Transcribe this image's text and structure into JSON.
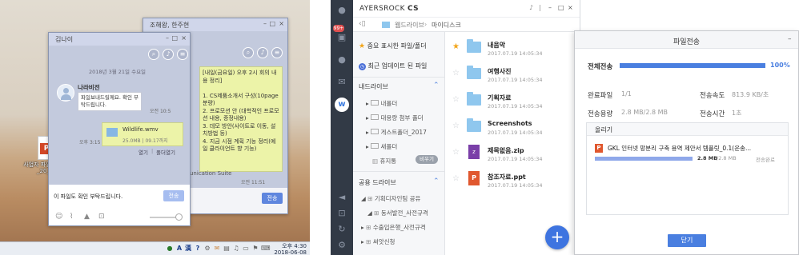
{
  "desktop": {
    "window_back": {
      "title": "조해왕, 한주현",
      "message": "[내일(금요일) 오후 2시 회의 내용 정리]\n\n1. CS제품소개서 구성(10page 분량)\n2. 프로모션 안 (대학적인 프로모션 내용, 증정내용)\n3. 데모 방안(사이트로 이동, 설치방법 등)\n4. 지금 시점 계획 기능 정리(예일 클라이언트 향 기능)",
      "suite_text": "unication Suite",
      "time1": "오전 11:51",
      "send_label": "전송"
    },
    "window_front": {
      "title": "김나이",
      "date_divider": "2018년 3월 21일 수요일",
      "sender": "나라비전",
      "message1": "파일보내드릴께요. 확인 부탁드립니다.",
      "time_msg1": "오전 10:5",
      "file_name": "Wildlife.wmv",
      "file_meta": "25.0MB | 09.17까지",
      "time_file": "오후 3:15",
      "open_label": "열기",
      "open_folder_label": "폴더열기",
      "input_text": "이 파일도 확인 부탁드립니다.",
      "send_label": "전송"
    },
    "desktop_file": {
      "label": "사업자 파일 가능_20_"
    },
    "taskbar": {
      "ime_a": "A",
      "ime_han": "漢",
      "time": "오후 4:30",
      "date": "2018-06-08"
    }
  },
  "app": {
    "brand": "AYERSROCK",
    "brand_suffix": "CS",
    "badge_count": "99+",
    "breadcrumb": {
      "root": "웹드라이브",
      "current": "마이디스크"
    },
    "sidebar": {
      "important": "중요 표시한 파일/폴더",
      "recent": "최근 업데이트 된 파일",
      "my_drive_header": "내드라이브",
      "my_drive_items": [
        "내폴더",
        "대용량 첨부 폴더",
        "게스트폴더_2017",
        "새폴더",
        "휴지통"
      ],
      "trash_badge": "비우기",
      "shared_header": "공용 드라이브",
      "shared_items": [
        "기획디자인팀 공유",
        "동서발전_사전규격",
        "수출입은행_사전규격",
        "써앗신청"
      ]
    },
    "files": [
      {
        "name": "내음악",
        "date": "2017.07.19  14:05:34",
        "type": "folder",
        "starred": true
      },
      {
        "name": "여행사진",
        "date": "2017.07.19  14:05:34",
        "type": "folder",
        "starred": false
      },
      {
        "name": "기획자료",
        "date": "2017.07.19  14:05:34",
        "type": "folder",
        "starred": false
      },
      {
        "name": "Screenshots",
        "date": "2017.07.19  14:05:34",
        "type": "folder",
        "starred": false
      },
      {
        "name": "제목없음.zip",
        "date": "2017.07.19  14:05:34",
        "type": "zip",
        "starred": false
      },
      {
        "name": "참조자료.ppt",
        "date": "2017.07.19  14:05:34",
        "type": "ppt",
        "starred": false
      }
    ],
    "fab_label": "+"
  },
  "transfer": {
    "title": "파일전송",
    "total_label": "전체전송",
    "total_percent": "100%",
    "total_progress": 1.0,
    "done_label": "완료파일",
    "done_value": "1/1",
    "speed_label": "전송속도",
    "speed_value": "813.9 KB/초",
    "size_label": "전송용량",
    "size_value": "2.8 MB/2.8 MB",
    "time_label": "전송시간",
    "time_value": "1초",
    "upload_header": "올리기",
    "item_name": "GKL 인터넷 망분리 구축 용역 제안서 템플릿_0.1(운송...",
    "item_done": "2.8 MB",
    "item_total": "/2.8 MB",
    "item_status": "전송완료",
    "item_progress": 1.0,
    "close_label": "닫기",
    "colors": {
      "accent": "#4a7fe0",
      "header_bg": "#f5f6f8"
    }
  }
}
